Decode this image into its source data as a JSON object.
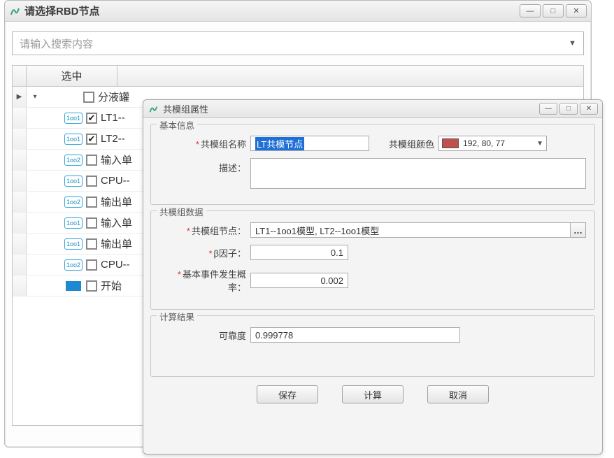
{
  "parent": {
    "title": "请选择RBD节点",
    "search_placeholder": "请输入搜索内容",
    "col_select": "选中",
    "rows": [
      {
        "indicator": "▶",
        "chev": "▾",
        "badge": "",
        "checked": false,
        "name": "分液罐"
      },
      {
        "indicator": "",
        "chev": "",
        "badge": "1oo1",
        "checked": true,
        "name": "LT1--"
      },
      {
        "indicator": "",
        "chev": "",
        "badge": "1oo1",
        "checked": true,
        "name": "LT2--"
      },
      {
        "indicator": "",
        "chev": "",
        "badge": "1oo2",
        "checked": false,
        "name": "输入单"
      },
      {
        "indicator": "",
        "chev": "",
        "badge": "1oo1",
        "checked": false,
        "name": "CPU--"
      },
      {
        "indicator": "",
        "chev": "",
        "badge": "1oo2",
        "checked": false,
        "name": "输出单"
      },
      {
        "indicator": "",
        "chev": "",
        "badge": "1oo1",
        "checked": false,
        "name": "输入单"
      },
      {
        "indicator": "",
        "chev": "",
        "badge": "1oo1",
        "checked": false,
        "name": "输出单"
      },
      {
        "indicator": "",
        "chev": "",
        "badge": "1oo2",
        "checked": false,
        "name": "CPU--"
      },
      {
        "indicator": "",
        "chev": "",
        "badge": "start",
        "checked": false,
        "name": "开始"
      }
    ]
  },
  "modal": {
    "title": "共模组属性",
    "group_basic": "基本信息",
    "group_data": "共模组数据",
    "group_result": "计算结果",
    "label_name": "共模组名称",
    "value_name": "LT共模节点",
    "label_color": "共模组颜色",
    "value_color": "192, 80, 77",
    "label_desc": "描述：",
    "label_nodes": "共模组节点：",
    "value_nodes": "LT1--1oo1模型, LT2--1oo1模型",
    "label_beta": "β因子：",
    "value_beta": "0.1",
    "label_prob": "基本事件发生概率：",
    "value_prob": "0.002",
    "label_reliab": "可靠度",
    "value_reliab": "0.999778",
    "btn_save": "保存",
    "btn_calc": "计算",
    "btn_cancel": "取消"
  }
}
